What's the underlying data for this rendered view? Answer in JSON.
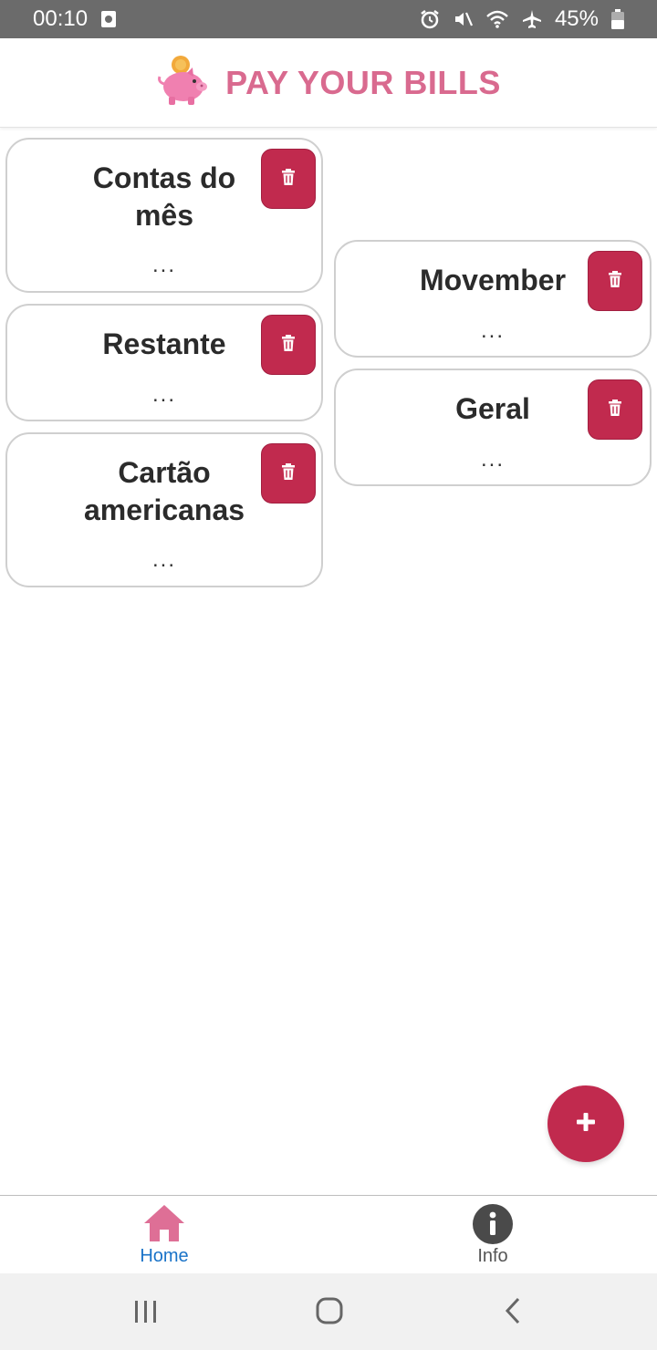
{
  "status_bar": {
    "time": "00:10",
    "battery": "45%"
  },
  "header": {
    "title": "PAY YOUR BILLS",
    "logo_icon": "piggy-bank-icon"
  },
  "cards": [
    {
      "title_line1": "Contas do",
      "title_line2": "mês",
      "subtitle": "..."
    },
    {
      "title_line1": "Restante",
      "subtitle": "..."
    },
    {
      "title_line1": "Cartão",
      "title_line2": "americanas",
      "subtitle": "..."
    },
    {
      "title_line1": "Movember",
      "subtitle": "..."
    },
    {
      "title_line1": "Geral",
      "subtitle": "..."
    }
  ],
  "fab": {
    "label": "+"
  },
  "bottom_nav": {
    "items": [
      {
        "label": "Home",
        "icon": "home-icon",
        "active": true
      },
      {
        "label": "Info",
        "icon": "info-icon",
        "active": false
      }
    ]
  },
  "colors": {
    "accent": "#c12a4e",
    "brand_pink": "#d96a8f",
    "active_nav": "#1a73c8",
    "inactive_nav": "#555555"
  }
}
